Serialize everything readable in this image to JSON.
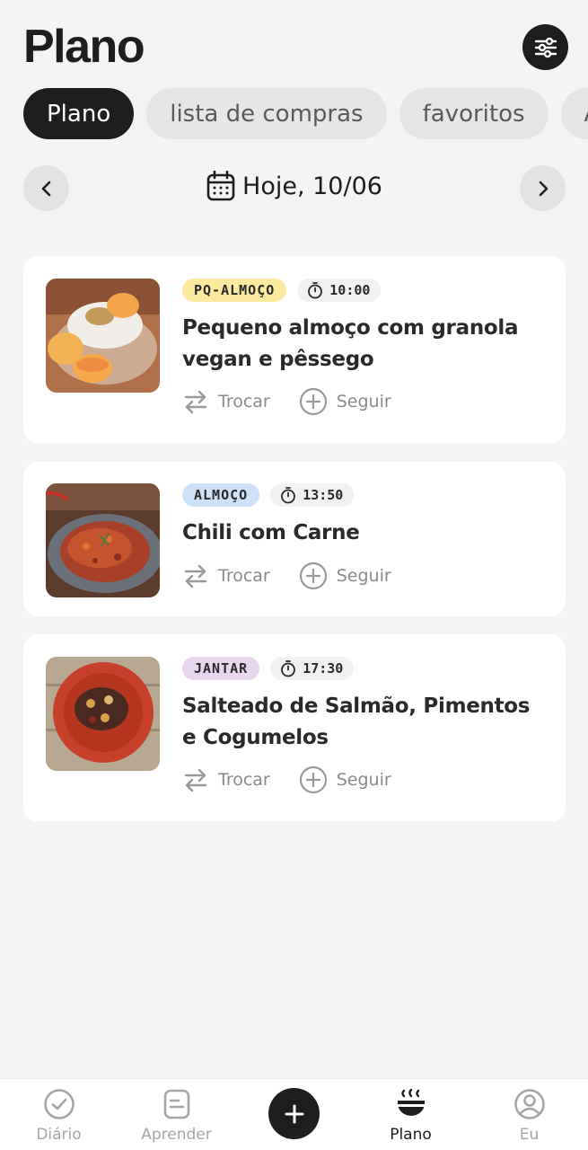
{
  "header": {
    "title": "Plano"
  },
  "tabs": [
    {
      "label": "Plano",
      "active": true
    },
    {
      "label": "lista de compras",
      "active": false
    },
    {
      "label": "favoritos",
      "active": false
    },
    {
      "label": "A",
      "active": false
    }
  ],
  "date_nav": {
    "label": "Hoje, 10/06"
  },
  "meals": [
    {
      "badge": "PQ-ALMOÇO",
      "badge_color": "#fbeaa0",
      "time": "10:00",
      "title": "Pequeno almoço com granola vegan e pêssego",
      "swap_label": "Trocar",
      "follow_label": "Seguir"
    },
    {
      "badge": "ALMOÇO",
      "badge_color": "#cfe1f7",
      "time": "13:50",
      "title": "Chili com Carne",
      "swap_label": "Trocar",
      "follow_label": "Seguir"
    },
    {
      "badge": "JANTAR",
      "badge_color": "#e8d6ef",
      "time": "17:30",
      "title": "Salteado de Salmão, Pimentos e Cogumelos",
      "swap_label": "Trocar",
      "follow_label": "Seguir"
    }
  ],
  "bottom_nav": [
    {
      "label": "Diário",
      "icon": "check-circle-icon"
    },
    {
      "label": "Aprender",
      "icon": "document-icon"
    },
    {
      "label": "Plano",
      "icon": "bowl-icon",
      "active": true
    },
    {
      "label": "Eu",
      "icon": "user-icon"
    }
  ]
}
